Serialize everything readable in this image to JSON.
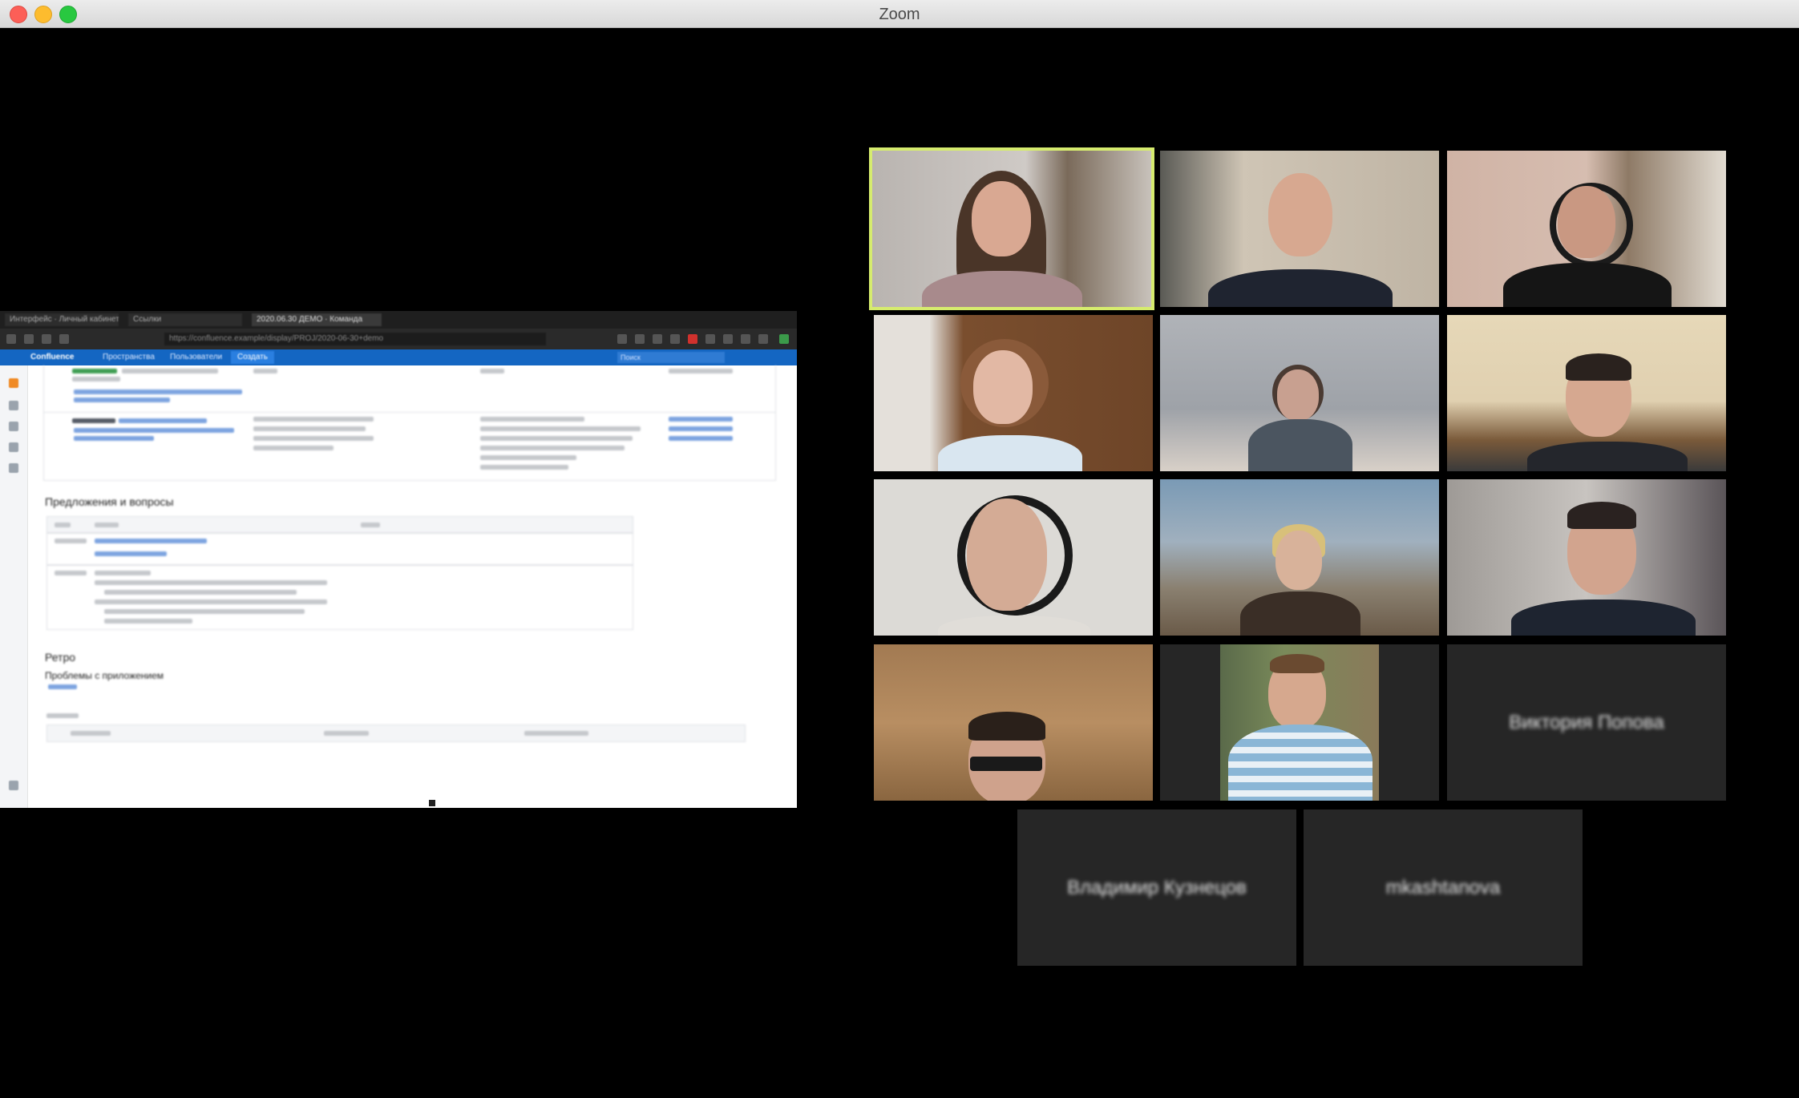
{
  "window": {
    "title": "Zoom"
  },
  "shared_screen": {
    "browser_tabs": [
      "Интерфейс · Личный кабинет",
      "Ссылки",
      "2020.06.30 ДЕМО · Команда"
    ],
    "url": "https://confluence.example/display/PROJ/2020-06-30+demo",
    "confluence_nav": [
      "Confluence",
      "Пространства",
      "Пользователи",
      "Создать"
    ],
    "search_placeholder": "Поиск",
    "sections": [
      "Предложения и вопросы",
      "Ретро",
      "Проблемы с приложением"
    ]
  },
  "participants": [
    {
      "id": "p1",
      "label": "",
      "video": true,
      "active_speaker": true
    },
    {
      "id": "p2",
      "label": "",
      "video": true,
      "active_speaker": false
    },
    {
      "id": "p3",
      "label": "",
      "video": true,
      "active_speaker": false
    },
    {
      "id": "p4",
      "label": "",
      "video": true,
      "active_speaker": false
    },
    {
      "id": "p5",
      "label": "",
      "video": true,
      "active_speaker": false
    },
    {
      "id": "p6",
      "label": "",
      "video": true,
      "active_speaker": false
    },
    {
      "id": "p7",
      "label": "",
      "video": true,
      "active_speaker": false
    },
    {
      "id": "p8",
      "label": "",
      "video": true,
      "active_speaker": false
    },
    {
      "id": "p9",
      "label": "",
      "video": true,
      "active_speaker": false
    },
    {
      "id": "p10",
      "label": "",
      "video": true,
      "active_speaker": false
    },
    {
      "id": "p11",
      "label": "",
      "video": true,
      "active_speaker": false
    },
    {
      "id": "p12",
      "label": "Виктория Попова",
      "video": false,
      "active_speaker": false
    },
    {
      "id": "p13",
      "label": "Владимир Кузнецов",
      "video": false,
      "active_speaker": false
    },
    {
      "id": "p14",
      "label": "mkashtanova",
      "video": false,
      "active_speaker": false
    }
  ],
  "colors": {
    "active_speaker_border": "#d6ec6e",
    "tile_background": "#262626",
    "confluence_blue": "#1466c2"
  }
}
